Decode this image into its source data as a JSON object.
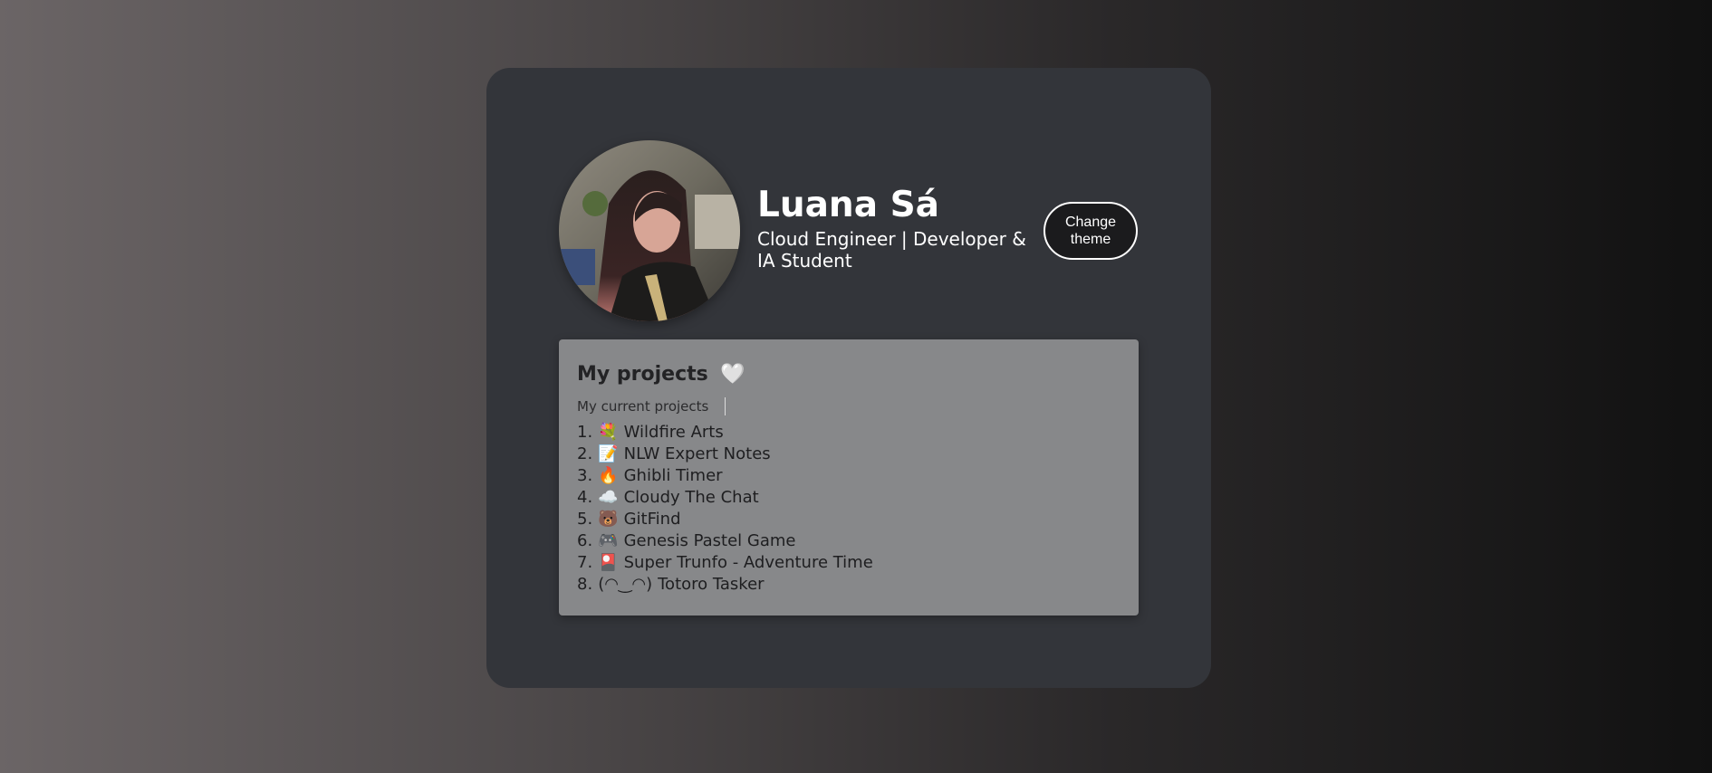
{
  "profile": {
    "name": "Luana Sá",
    "subtitle": "Cloud Engineer | Developer & IA Student",
    "avatar_icon": "profile-photo"
  },
  "theme_button": {
    "label": "Change theme"
  },
  "projects": {
    "title": "My projects",
    "title_emoji": "🤍",
    "subtitle": "My current projects",
    "items": [
      {
        "number": "1.",
        "emoji": "💐",
        "label": "Wildfire Arts"
      },
      {
        "number": "2.",
        "emoji": "📝",
        "label": "NLW Expert Notes"
      },
      {
        "number": "3.",
        "emoji": "🔥",
        "label": "Ghibli Timer"
      },
      {
        "number": "4.",
        "emoji": "☁️",
        "label": "Cloudy The Chat"
      },
      {
        "number": "5.",
        "emoji": "🐻",
        "label": "GitFind"
      },
      {
        "number": "6.",
        "emoji": "🎮",
        "label": "Genesis Pastel Game"
      },
      {
        "number": "7.",
        "emoji": "🎴",
        "label": "Super Trunfo - Adventure Time"
      },
      {
        "number": "8.",
        "emoji": "(◠‿◠)",
        "label": "Totoro Tasker"
      }
    ]
  },
  "colors": {
    "card_bg": "#33353a",
    "panel_bg": "#87888a",
    "button_bg": "#1b1b1d",
    "text_light": "#ffffff"
  }
}
